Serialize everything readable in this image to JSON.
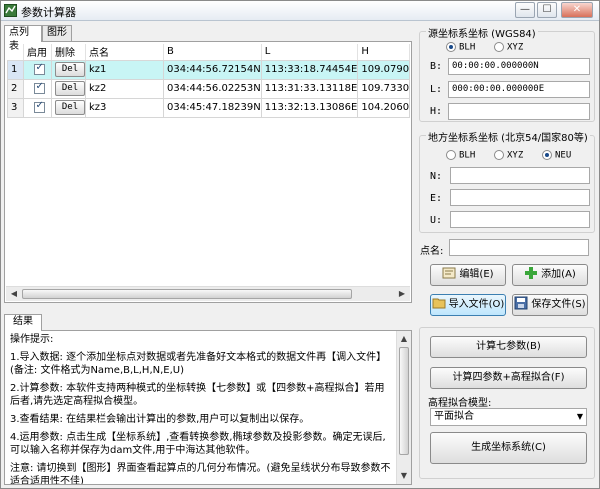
{
  "window": {
    "title": "参数计算器",
    "min_glyph": "—",
    "max_glyph": "☐",
    "close_glyph": "✕"
  },
  "tabs_top": [
    "点列表",
    "图形"
  ],
  "table": {
    "columns": [
      "启用",
      "删除",
      "点名",
      "B",
      "L",
      "H"
    ],
    "rows": [
      {
        "num": "1",
        "enabled": true,
        "del": "Del",
        "name": "kz1",
        "B": "034:44:56.72154N",
        "L": "113:33:18.74454E",
        "H": "109.0790"
      },
      {
        "num": "2",
        "enabled": true,
        "del": "Del",
        "name": "kz2",
        "B": "034:44:56.02253N",
        "L": "113:31:33.13118E",
        "H": "109.7330"
      },
      {
        "num": "3",
        "enabled": true,
        "del": "Del",
        "name": "kz3",
        "B": "034:45:47.18239N",
        "L": "113:32:13.13086E",
        "H": "104.2060"
      }
    ],
    "selected_row": 1
  },
  "source": {
    "title": "源坐标系坐标 (WGS84)",
    "radios": [
      {
        "label": "BLH",
        "checked": true
      },
      {
        "label": "XYZ",
        "checked": false
      }
    ],
    "fields": [
      {
        "label": "B:",
        "value": "00:00:00.000000N"
      },
      {
        "label": "L:",
        "value": "000:00:00.000000E"
      },
      {
        "label": "H:",
        "value": ""
      }
    ]
  },
  "local": {
    "title": "地方坐标系坐标 (北京54/国家80等)",
    "radios": [
      {
        "label": "BLH",
        "checked": false
      },
      {
        "label": "XYZ",
        "checked": false
      },
      {
        "label": "NEU",
        "checked": true
      }
    ],
    "fields": [
      {
        "label": "N:",
        "value": ""
      },
      {
        "label": "E:",
        "value": ""
      },
      {
        "label": "U:",
        "value": ""
      }
    ]
  },
  "point_name": {
    "label": "点名:",
    "value": ""
  },
  "buttons": {
    "edit": "编辑(E)",
    "add": "添加(A)",
    "import": "导入文件(O)",
    "save": "保存文件(S)",
    "calc7": "计算七参数(B)",
    "calc4": "计算四参数+高程拟合(F)",
    "gen": "生成坐标系统(C)"
  },
  "elev_model": {
    "label": "高程拟合模型:",
    "selected": "平面拟合"
  },
  "results": {
    "tab": "结果",
    "lines": [
      "操作提示:",
      "1.导入数据: 逐个添加坐标点对数据或者先准备好文本格式的数据文件再【调入文件】(备注: 文件格式为Name,B,L,H,N,E,U)",
      "2.计算参数: 本软件支持两种模式的坐标转换【七参数】或【四参数+高程拟合】若用后者,请先选定高程拟合模型。",
      "3.查看结果: 在结果栏会输出计算出的参数,用户可以复制出以保存。",
      "4.运用参数: 点击生成【坐标系统】,查看转换参数,椭球参数及投影参数。确定无误后,可以输入名称并保存为dam文件,用于中海达其他软件。",
      "注意: 请切换到【图形】界面查看起算点的几何分布情况。(避免呈线状分布导致参数不适合适用性不佳)"
    ]
  },
  "colors": {
    "selected_row": "#c8f5f5",
    "focus_border": "#3c7fb1"
  }
}
